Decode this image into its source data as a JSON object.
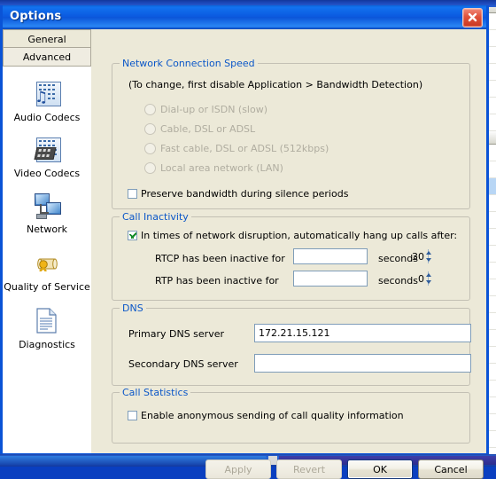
{
  "window": {
    "title": "Options",
    "close_icon": "close-icon"
  },
  "sidebar": {
    "tabs": [
      {
        "label": "General",
        "active": false
      },
      {
        "label": "Advanced",
        "active": true
      }
    ],
    "items": [
      {
        "label": "Audio Codecs",
        "icon": "audio-codecs-icon"
      },
      {
        "label": "Video Codecs",
        "icon": "video-codecs-icon"
      },
      {
        "label": "Network",
        "icon": "network-icon"
      },
      {
        "label": "Quality of Service",
        "icon": "quality-of-service-icon"
      },
      {
        "label": "Diagnostics",
        "icon": "diagnostics-icon"
      }
    ]
  },
  "network_speed": {
    "legend": "Network Connection Speed",
    "note": "(To change, first disable Application > Bandwidth Detection)",
    "options": [
      {
        "label": "Dial-up or ISDN (slow)",
        "selected": false,
        "disabled": true
      },
      {
        "label": "Cable, DSL or ADSL",
        "selected": false,
        "disabled": true
      },
      {
        "label": "Fast cable, DSL or ADSL (512kbps)",
        "selected": false,
        "disabled": true
      },
      {
        "label": "Local area network (LAN)",
        "selected": false,
        "disabled": true
      }
    ],
    "preserve_bandwidth": {
      "label": "Preserve bandwidth during silence periods",
      "checked": false
    }
  },
  "call_inactivity": {
    "legend": "Call Inactivity",
    "enable": {
      "label": "In times of network disruption, automatically hang up calls after:",
      "checked": true
    },
    "rows": [
      {
        "label": "RTCP has been inactive for",
        "value": "30",
        "unit": "seconds"
      },
      {
        "label": "RTP has been inactive for",
        "value": "0",
        "unit": "seconds"
      }
    ]
  },
  "dns": {
    "legend": "DNS",
    "fields": [
      {
        "label": "Primary DNS server",
        "value": "172.21.15.121",
        "placeholder": ""
      },
      {
        "label": "Secondary DNS server",
        "value": "",
        "placeholder": ""
      }
    ]
  },
  "call_statistics": {
    "legend": "Call Statistics",
    "enable_anonymous": {
      "label": "Enable anonymous sending of call quality information",
      "checked": false
    }
  },
  "footer": {
    "apply": "Apply",
    "revert": "Revert",
    "ok": "OK",
    "cancel": "Cancel"
  },
  "colors": {
    "accent_blue": "#0b57c8",
    "titlebar_blue": "#0b5ae0",
    "dialog_face": "#ece9d8",
    "close_red": "#c93620",
    "check_green": "#128a28"
  }
}
